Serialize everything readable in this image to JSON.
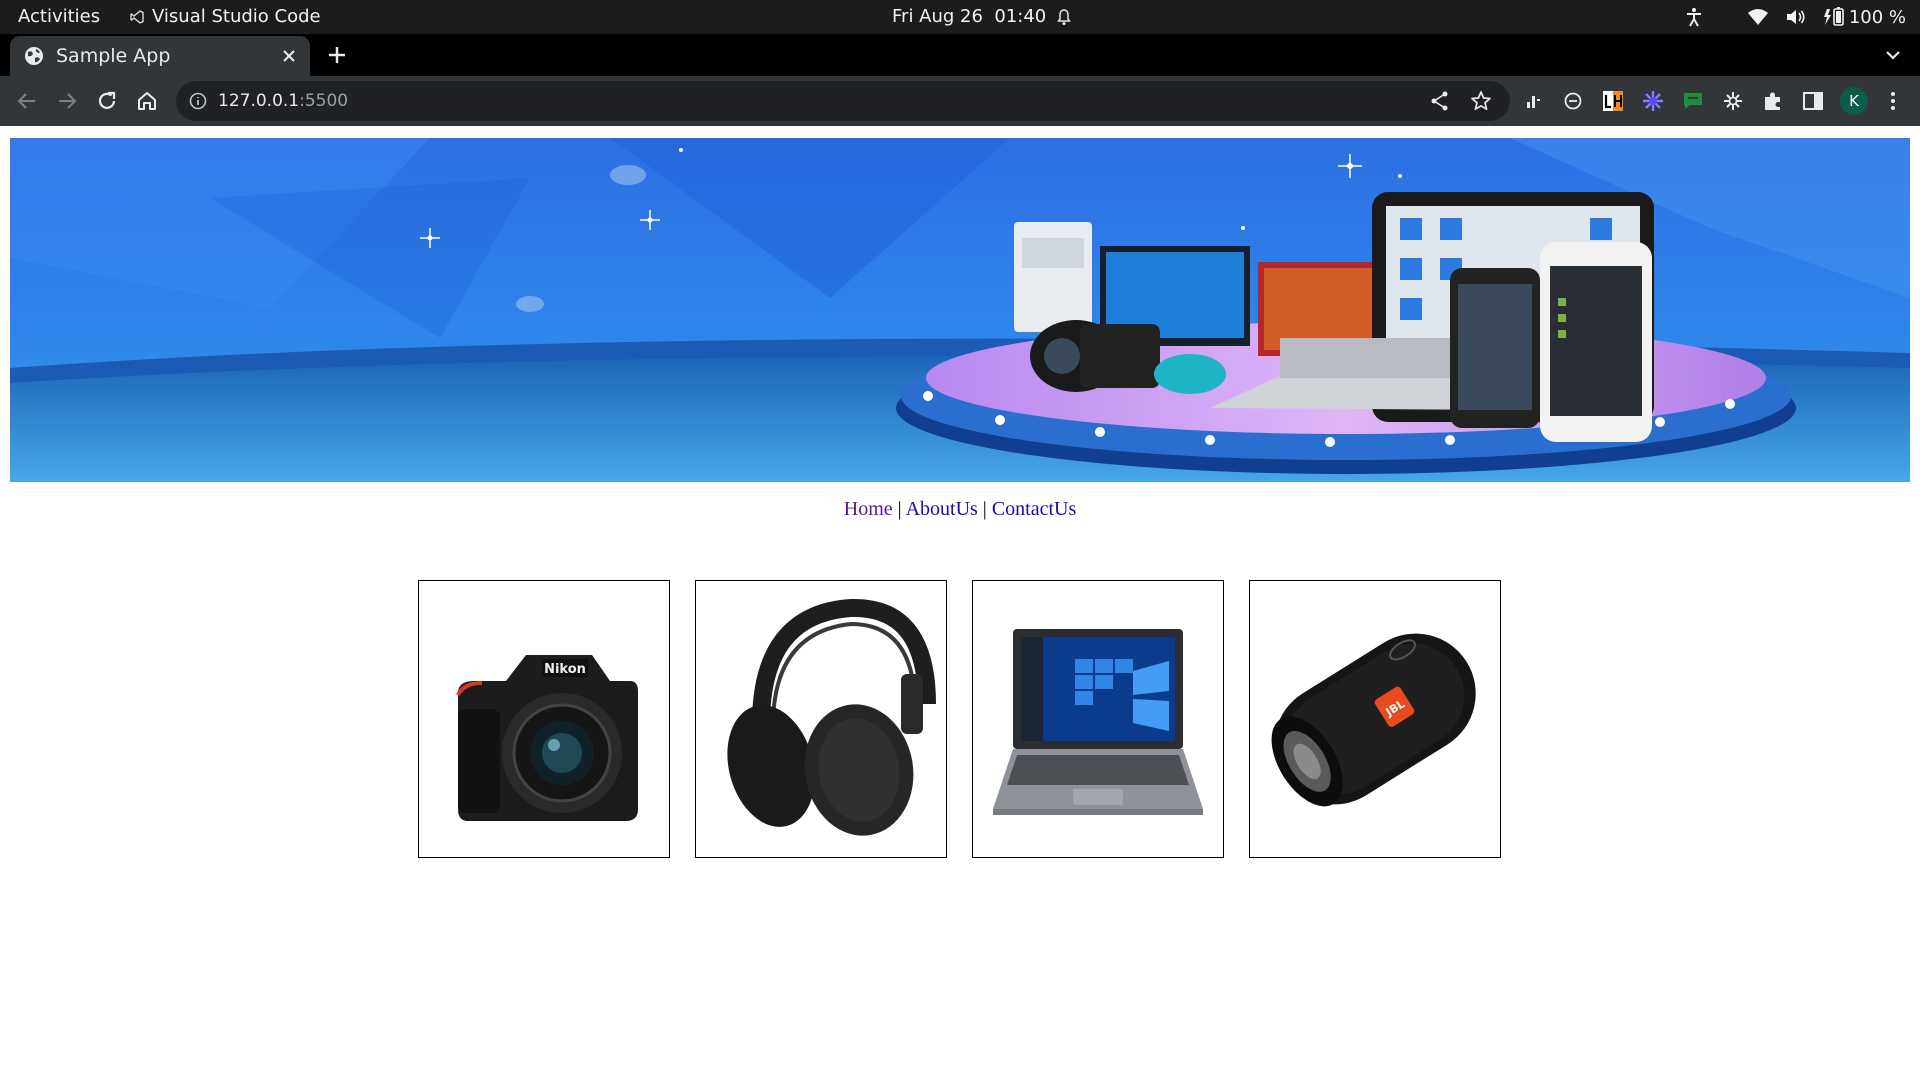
{
  "system_bar": {
    "activities_label": "Activities",
    "app_name": "Visual Studio Code",
    "datetime": "Fri Aug 26  01:40",
    "battery_percent": "100 %"
  },
  "browser": {
    "tab_title": "Sample App",
    "url_host": "127.0.0.1",
    "url_port": ":5500",
    "profile_initial": "K"
  },
  "page": {
    "nav": {
      "home": "Home",
      "about": "AboutUs",
      "contact": "ContactUs",
      "separator": "|"
    },
    "products": [
      {
        "name": "camera"
      },
      {
        "name": "headphones"
      },
      {
        "name": "laptop"
      },
      {
        "name": "speaker"
      }
    ]
  },
  "colors": {
    "banner_blue": "#2f7ee6",
    "platform_purple": "#c99af3",
    "link_blue": "#1a0dab",
    "link_visited": "#551a8b",
    "jbl_orange": "#e84c1e"
  }
}
